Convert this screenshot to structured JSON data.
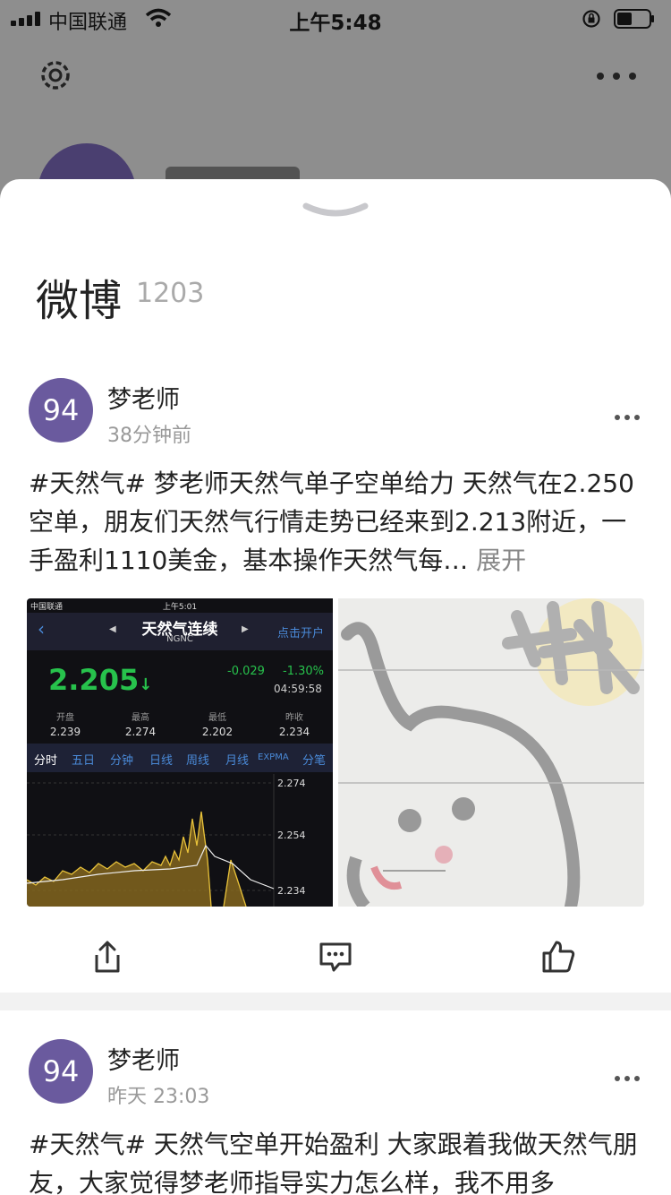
{
  "status": {
    "carrier": "中国联通",
    "time": "上午5:48"
  },
  "sheet": {
    "title": "微博",
    "count": "1203"
  },
  "posts": [
    {
      "avatar": "94",
      "name": "梦老师",
      "time": "38分钟前",
      "text": "#天然气# 梦老师天然气单子空单给力 天然气在2.250空单，朋友们天然气行情走势已经来到2.213附近，一手盈利1110美金，基本操作天然气每…",
      "expand": "展开"
    },
    {
      "avatar": "94",
      "name": "梦老师",
      "time": "昨天 23:03",
      "text": "#天然气# 天然气空单开始盈利 大家跟着我做天然气朋友，大家觉得梦老师指导实力怎么样，我不用多"
    }
  ],
  "stock_image": {
    "carrier": "中国联通",
    "time": "上午5:01",
    "title": "天然气连续",
    "symbol": "NGNC",
    "open_account": "点击开户",
    "price": "2.205",
    "change": "-0.029",
    "change_pct": "-1.30%",
    "quote_time": "04:59:58",
    "stats": [
      {
        "label": "开盘",
        "value": "2.239"
      },
      {
        "label": "最高",
        "value": "2.274"
      },
      {
        "label": "最低",
        "value": "2.202"
      },
      {
        "label": "昨收",
        "value": "2.234"
      }
    ],
    "tabs": [
      "分时",
      "五日",
      "分钟",
      "日线",
      "周线",
      "月线",
      "EXPMA",
      "分笔"
    ],
    "y_labels": [
      "2.274",
      "2.254",
      "2.234"
    ]
  },
  "icons": {
    "settings": "gear-icon",
    "more": "more-dots-icon",
    "collapse": "chevron-down-icon",
    "share": "share-icon",
    "comment": "comment-icon",
    "like": "like-icon"
  }
}
